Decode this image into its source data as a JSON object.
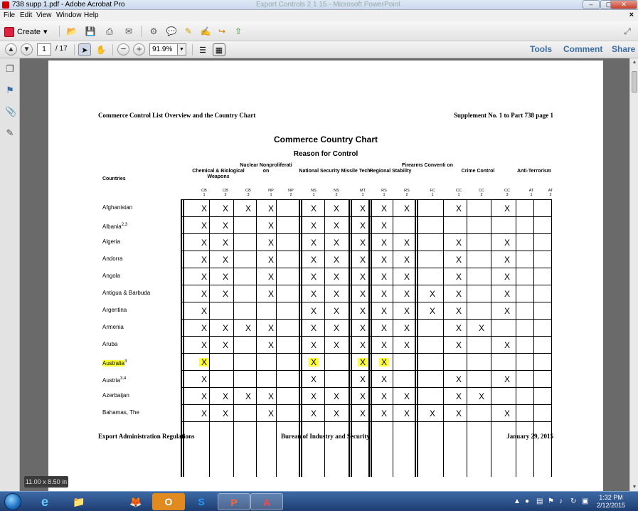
{
  "window": {
    "title": "738 supp 1.pdf - Adobe Acrobat Pro",
    "faded_title": "Export Controls 2 1 15 - Microsoft PowerPoint",
    "min_label": "–",
    "max_label": "▢",
    "close_label": "✕"
  },
  "menu": {
    "items": [
      "File",
      "Edit",
      "View",
      "Window",
      "Help"
    ],
    "close_doc": "×"
  },
  "toolbar": {
    "create_label": "Create",
    "create_arrow": "▾"
  },
  "nav": {
    "page_current": "1",
    "page_total": "/ 17",
    "zoom": "91.9%",
    "tools": "Tools",
    "comment": "Comment",
    "share": "Share"
  },
  "page_size_badge": "11.00 x 8.50 in",
  "doc": {
    "header_left": "Commerce Control List Overview and the Country Chart",
    "header_right": "Supplement No. 1 to Part 738 page 1",
    "title": "Commerce Country Chart",
    "subtitle": "Reason for Control",
    "countries_label": "Countries",
    "footer_left": "Export Administration Regulations",
    "footer_center": "Bureau of Industry and Security",
    "footer_right": "January 29, 2015",
    "groups": [
      {
        "label": "Chemical & Biological Weapons"
      },
      {
        "label": "Nuclear Nonproliferati on"
      },
      {
        "label": "National Security"
      },
      {
        "label": "Missile Tech"
      },
      {
        "label": "Regional Stability"
      },
      {
        "label": "Firearms Conventi on"
      },
      {
        "label": "Crime Control"
      },
      {
        "label": "Anti-Terrorism"
      }
    ],
    "columns": [
      {
        "code": "CB",
        "num": "1"
      },
      {
        "code": "CB",
        "num": "2"
      },
      {
        "code": "CB",
        "num": "3"
      },
      {
        "code": "NP",
        "num": "1"
      },
      {
        "code": "NP",
        "num": "2"
      },
      {
        "code": "NS",
        "num": "1"
      },
      {
        "code": "NS",
        "num": "2"
      },
      {
        "code": "MT",
        "num": "1"
      },
      {
        "code": "RS",
        "num": "1"
      },
      {
        "code": "RS",
        "num": "2"
      },
      {
        "code": "FC",
        "num": "1"
      },
      {
        "code": "CC",
        "num": "1"
      },
      {
        "code": "CC",
        "num": "2"
      },
      {
        "code": "CC",
        "num": "3"
      },
      {
        "code": "AT",
        "num": "1"
      },
      {
        "code": "AT",
        "num": "2"
      }
    ],
    "mark": "X",
    "rows": [
      {
        "name": "Afghanistan",
        "sup": "",
        "highlight": false,
        "marks": [
          1,
          1,
          1,
          1,
          0,
          1,
          1,
          1,
          1,
          1,
          0,
          1,
          0,
          1,
          0,
          0
        ]
      },
      {
        "name": "Albania",
        "sup": "2,3",
        "highlight": false,
        "marks": [
          1,
          1,
          0,
          1,
          0,
          1,
          1,
          1,
          1,
          0,
          0,
          0,
          0,
          0,
          0,
          0
        ]
      },
      {
        "name": "Algeria",
        "sup": "",
        "highlight": false,
        "marks": [
          1,
          1,
          0,
          1,
          0,
          1,
          1,
          1,
          1,
          1,
          0,
          1,
          0,
          1,
          0,
          0
        ]
      },
      {
        "name": "Andorra",
        "sup": "",
        "highlight": false,
        "marks": [
          1,
          1,
          0,
          1,
          0,
          1,
          1,
          1,
          1,
          1,
          0,
          1,
          0,
          1,
          0,
          0
        ]
      },
      {
        "name": "Angola",
        "sup": "",
        "highlight": false,
        "marks": [
          1,
          1,
          0,
          1,
          0,
          1,
          1,
          1,
          1,
          1,
          0,
          1,
          0,
          1,
          0,
          0
        ]
      },
      {
        "name": "Antigua & Barbuda",
        "sup": "",
        "highlight": false,
        "marks": [
          1,
          1,
          0,
          1,
          0,
          1,
          1,
          1,
          1,
          1,
          1,
          1,
          0,
          1,
          0,
          0
        ]
      },
      {
        "name": "Argentina",
        "sup": "",
        "highlight": false,
        "marks": [
          1,
          0,
          0,
          0,
          0,
          1,
          1,
          1,
          1,
          1,
          1,
          1,
          0,
          1,
          0,
          0
        ]
      },
      {
        "name": "Armenia",
        "sup": "",
        "highlight": false,
        "marks": [
          1,
          1,
          1,
          1,
          0,
          1,
          1,
          1,
          1,
          1,
          0,
          1,
          1,
          0,
          0,
          0
        ]
      },
      {
        "name": "Aruba",
        "sup": "",
        "highlight": false,
        "marks": [
          1,
          1,
          0,
          1,
          0,
          1,
          1,
          1,
          1,
          1,
          0,
          1,
          0,
          1,
          0,
          0
        ]
      },
      {
        "name": "Australia",
        "sup": "3",
        "highlight": true,
        "marks": [
          1,
          0,
          0,
          0,
          0,
          1,
          0,
          1,
          1,
          0,
          0,
          0,
          0,
          0,
          0,
          0
        ]
      },
      {
        "name": "Austria",
        "sup": "3,4",
        "highlight": false,
        "marks": [
          1,
          0,
          0,
          0,
          0,
          1,
          0,
          1,
          1,
          0,
          0,
          1,
          0,
          1,
          0,
          0
        ]
      },
      {
        "name": "Azerbaijan",
        "sup": "",
        "highlight": false,
        "marks": [
          1,
          1,
          1,
          1,
          0,
          1,
          1,
          1,
          1,
          1,
          0,
          1,
          1,
          0,
          0,
          0
        ]
      },
      {
        "name": "Bahamas, The",
        "sup": "",
        "highlight": false,
        "marks": [
          1,
          1,
          0,
          1,
          0,
          1,
          1,
          1,
          1,
          1,
          1,
          1,
          0,
          1,
          0,
          0
        ]
      }
    ]
  },
  "taskbar": {
    "apps": [
      "e",
      "📁",
      "🦊",
      "O",
      "S",
      "P",
      "A"
    ],
    "time": "1:32 PM",
    "date": "2/12/2015"
  }
}
